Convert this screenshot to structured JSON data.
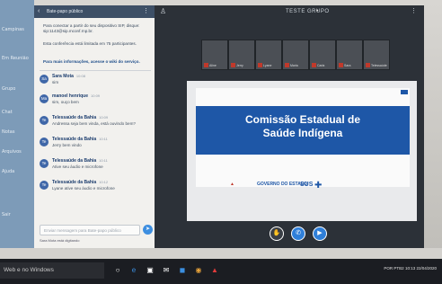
{
  "app": {
    "sidebar_items": [
      "Campinas",
      "Em Reunião",
      "Grupo",
      "Chat",
      "Notas",
      "Arquivos",
      "Ajuda",
      "Sair"
    ]
  },
  "chat": {
    "header": "Bate-papo público",
    "notice1": "Para conectar a partir do seu dispositivo SIP, disque: sip:1143@sip.mconf.rnp.br.",
    "notice2": "Esta conferência está limitada em 75 participantes.",
    "notice3": "Para mais informações, acesse o wiki do serviço.",
    "messages": [
      {
        "initials": "Sa",
        "name": "Sara Mota",
        "time": "10:08",
        "text": "sim"
      },
      {
        "initials": "Ma",
        "name": "manoel henrique",
        "time": "10:09",
        "text": "sim, ouço bem"
      },
      {
        "initials": "Te",
        "name": "Telessaúde da Bahia",
        "time": "10:09",
        "text": "Andressa seja bem vinda, está ouvindo bem?"
      },
      {
        "initials": "Te",
        "name": "Telessaúde da Bahia",
        "time": "10:11",
        "text": "Jerry bem vindo"
      },
      {
        "initials": "Te",
        "name": "Telessaúde da Bahia",
        "time": "10:11",
        "text": "Ative seu áudio e microfone"
      },
      {
        "initials": "Te",
        "name": "Telessaúde da Bahia",
        "time": "10:12",
        "text": "Lyane ative seu áudio e microfone"
      }
    ],
    "input_placeholder": "Enviar mensagem para Bate-papo público",
    "typing": "Sara Mota está digitando"
  },
  "meeting": {
    "title": "TESTE GRUPO",
    "thumbnails": [
      "Aline",
      "Jerry",
      "Lyane",
      "Maria",
      "Carla",
      "Sara",
      "Telessaúde"
    ],
    "slide_title_line1": "Comissão Estadual de",
    "slide_title_line2": "Saúde Indígena",
    "logo_gov": "GOVERNO DO ESTADO",
    "logo_sus": "SUS"
  },
  "taskbar": {
    "search": "Web e no Windows",
    "time": "10:13",
    "date": "22/04/2020",
    "lang": "POR PTB2"
  },
  "colors": {
    "slide_band": "#1e57a7",
    "chat_header": "#3d4f66",
    "accent": "#2f7fd9"
  }
}
